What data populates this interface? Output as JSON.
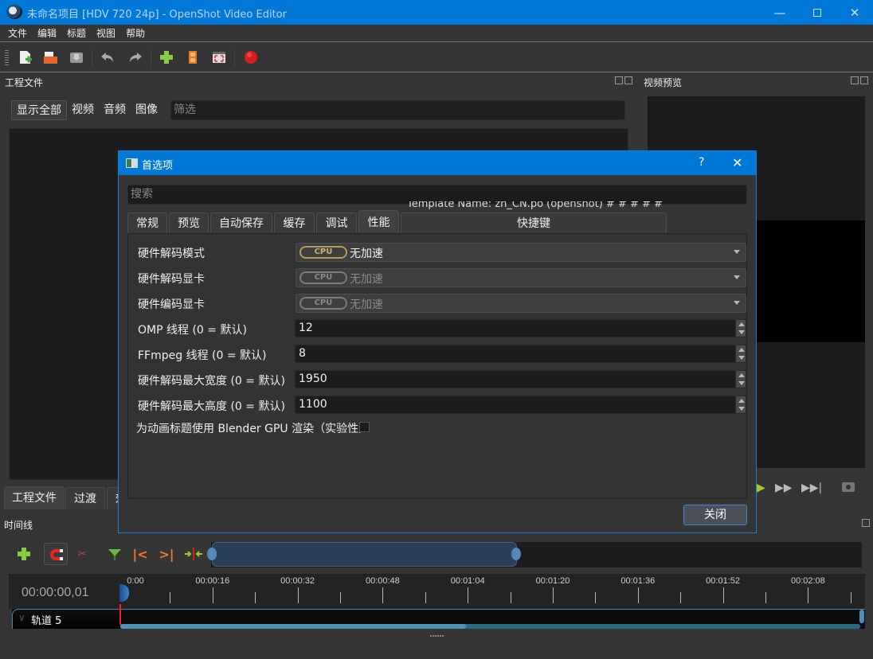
{
  "window": {
    "title": "未命名项目 [HDV 720 24p] - OpenShot Video Editor",
    "minimize_icon": "minimize-icon",
    "maximize_icon": "maximize-icon",
    "close_icon": "close-icon"
  },
  "menu": [
    "文件",
    "编辑",
    "标题",
    "视图",
    "帮助"
  ],
  "toolbar": {
    "icons": [
      "new-project-icon",
      "open-project-icon",
      "save-project-icon",
      "undo-icon",
      "redo-icon",
      "import-files-icon",
      "profile-icon",
      "fullscreen-icon",
      "export-video-icon"
    ]
  },
  "project_files": {
    "title": "工程文件",
    "filters": [
      "显示全部",
      "视频",
      "音频",
      "图像"
    ],
    "filter_placeholder": "筛选"
  },
  "bottom_tabs": [
    "工程文件",
    "过渡",
    "效"
  ],
  "video_preview": {
    "title": "视频预览"
  },
  "timeline": {
    "title": "时间线",
    "timecode": "00:00:00,01",
    "ruler_labels": [
      "0:00",
      "00:00:16",
      "00:00:32",
      "00:00:48",
      "00:01:04",
      "00:01:20",
      "00:01:36",
      "00:01:52",
      "00:02:08"
    ],
    "track_name": "轨道 5",
    "zoom_selection": {
      "start_fraction": 0.0,
      "end_fraction": 0.47
    },
    "scroll_fraction": 0.47
  },
  "dialog": {
    "title": "首选项",
    "help_label": "?",
    "search_placeholder": "搜索",
    "ghost_text": "Template Name: zh_CN.po (openshot) # # # # #",
    "tabs": [
      "常规",
      "预览",
      "自动保存",
      "缓存",
      "调试",
      "性能",
      "快捷键"
    ],
    "active_tab": "性能",
    "fields": [
      {
        "label": "硬件解码模式",
        "type": "combo",
        "badge": "CPU",
        "value": "无加速",
        "enabled": true
      },
      {
        "label": "硬件解码显卡",
        "type": "combo",
        "badge": "CPU",
        "value": "无加速",
        "enabled": false
      },
      {
        "label": "硬件编码显卡",
        "type": "combo",
        "badge": "CPU",
        "value": "无加速",
        "enabled": false
      },
      {
        "label": "OMP 线程 (0 = 默认)",
        "type": "spin",
        "value": "12"
      },
      {
        "label": "FFmpeg 线程 (0 = 默认)",
        "type": "spin",
        "value": "8"
      },
      {
        "label": "硬件解码最大宽度 (0 = 默认)",
        "type": "spin",
        "value": "1950"
      },
      {
        "label": "硬件解码最大高度 (0 = 默认)",
        "type": "spin",
        "value": "1100"
      }
    ],
    "checkbox_label": "为动画标题使用 Blender GPU 渲染（实验性）",
    "checkbox_checked": false,
    "close_label": "关闭"
  }
}
